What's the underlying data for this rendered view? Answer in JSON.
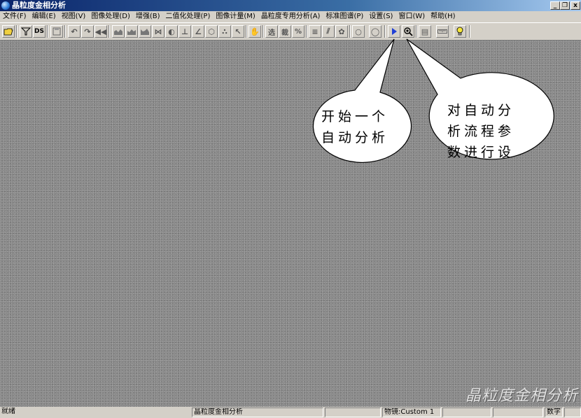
{
  "window": {
    "title": "晶粒度金相分析",
    "controls": {
      "minimize": "_",
      "restore": "❐",
      "close": "x"
    }
  },
  "menu": [
    "文件(F)",
    "编辑(E)",
    "视图(V)",
    "图像处理(D)",
    "增强(B)",
    "二值化处理(P)",
    "图像计量(M)",
    "晶粒度专用分析(A)",
    "标准图谱(P)",
    "设置(S)",
    "窗口(W)",
    "帮助(H)"
  ],
  "toolbar": {
    "ds_label": "DS",
    "select_label": "选",
    "cut_label": "裁",
    "percent_label": "%"
  },
  "workspace": {
    "watermark": "晶粒度金相分析"
  },
  "callouts": {
    "start": "开始一个\n自动分析",
    "settings": "对自动分\n析流程参\n数进行设"
  },
  "status": {
    "ready": "就绪",
    "app": "晶粒度金相分析",
    "objective": "物镜:Custom 1",
    "mode": "数字"
  },
  "colors": {
    "titlebar": "#0a246a",
    "chrome": "#d4d0c8",
    "workspace": "#8a8a8a",
    "play_button": "#1f3fd6",
    "bulb": "#f5e63a",
    "folder": "#f0d040"
  }
}
